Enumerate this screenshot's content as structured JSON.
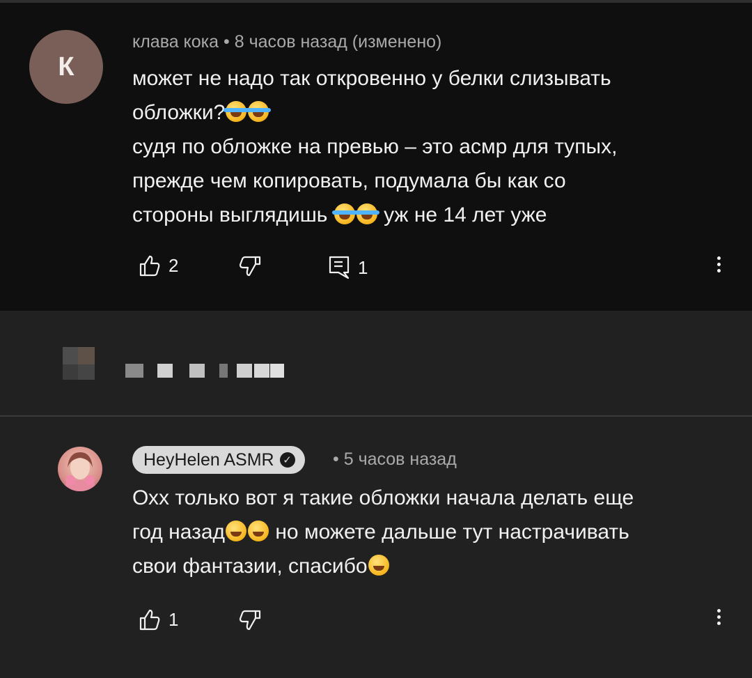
{
  "comments": [
    {
      "author": "клава кока",
      "avatar_letter": "К",
      "avatar_color": "#7a5f58",
      "separator": "•",
      "time": "8 часов назад",
      "edited": "(изменено)",
      "lines": [
        "может не надо так откровенно у белки слизывать",
        "обложки?",
        "судя по обложке на превью – это асмр для тупых,",
        "прежде чем копировать, подумала бы как со",
        "стороны выглядишь ",
        " уж не 14 лет уже"
      ],
      "likes": "2",
      "replies": "1"
    },
    {
      "author": "HeyHelen ASMR",
      "separator": "•",
      "time": "5 часов назад",
      "verified": true,
      "lines": [
        "Охх только вот я такие обложки начала делать еще",
        "год назад",
        " но можете дальше тут настрачивать",
        "свои фантазии, спасибо"
      ],
      "likes": "1"
    }
  ],
  "icons": {
    "like": "thumbs-up-icon",
    "dislike": "thumbs-down-icon",
    "reply": "comment-icon",
    "more": "more-vertical-icon",
    "verified": "verified-check-icon",
    "emoji_laugh": "rolling-on-floor-laughing-emoji",
    "emoji_joy": "grinning-sweat-emoji",
    "emoji_wink": "winking-face-emoji",
    "emoji_smile": "smiling-face-emoji"
  },
  "colors": {
    "background": "#212121",
    "highlighted_comment_bg": "#0f0f0f",
    "meta_text": "#aaaaaa",
    "pill_bg": "#d9d9d9"
  }
}
